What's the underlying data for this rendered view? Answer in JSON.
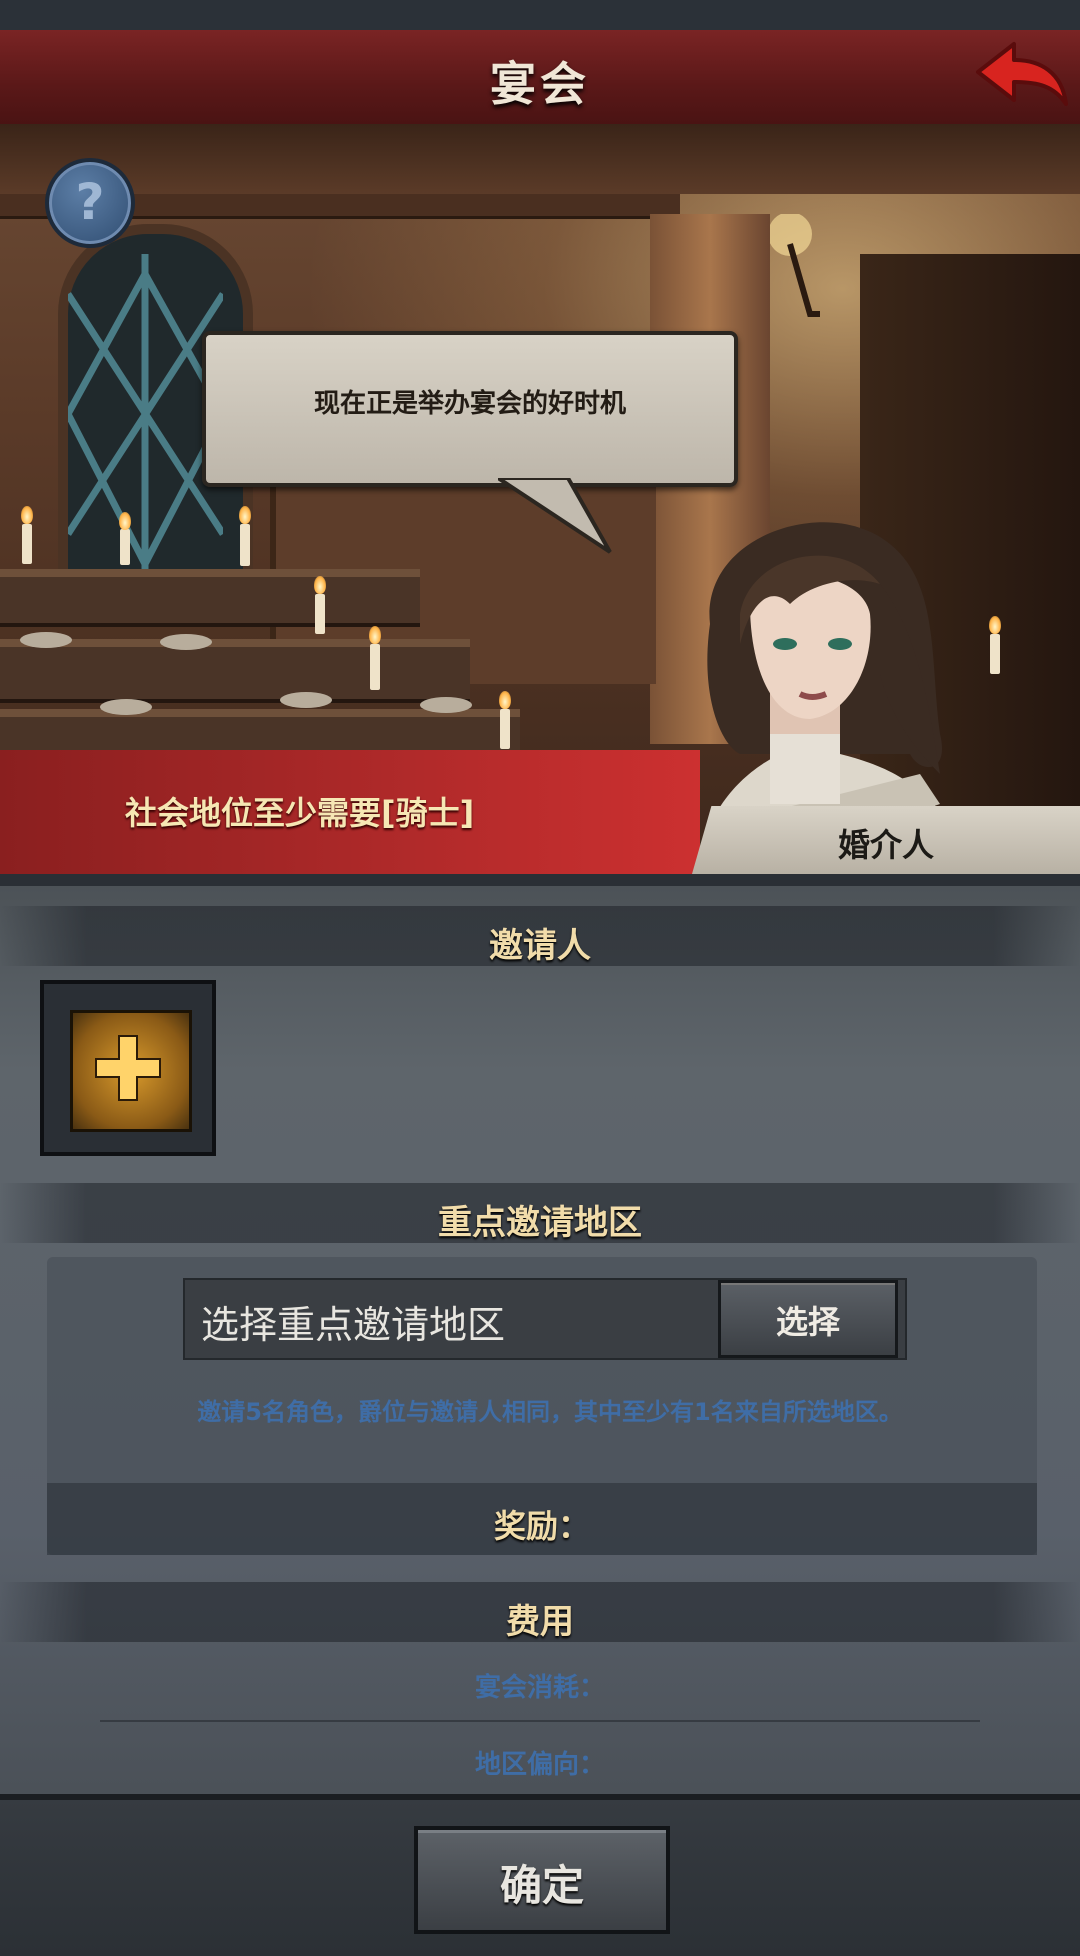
{
  "header": {
    "title": "宴会",
    "back_icon": "back-arrow-icon"
  },
  "scene": {
    "help_icon": "question-mark-icon",
    "help_glyph": "?",
    "speech_text": "现在正是举办宴会的好时机",
    "requirement_text": "社会地位至少需要[骑士]",
    "npc_name": "婚介人"
  },
  "inviter": {
    "heading": "邀请人",
    "add_icon": "plus-icon"
  },
  "region": {
    "heading": "重点邀请地区",
    "placeholder": "选择重点邀请地区",
    "select_label": "选择",
    "hint": "邀请5名角色，爵位与邀请人相同，其中至少有1名来自所选地区。",
    "reward_label": "奖励："
  },
  "cost": {
    "heading": "费用",
    "feast_cost_label": "宴会消耗：",
    "region_bias_label": "地区偏向："
  },
  "footer": {
    "confirm_label": "确定"
  },
  "colors": {
    "title_bar": "#6a1d1d",
    "requirement_bg": "#b12a2a",
    "heading_text": "#f1dcaa",
    "hint_text": "#3f6da6",
    "add_button": "#d89a2c"
  }
}
